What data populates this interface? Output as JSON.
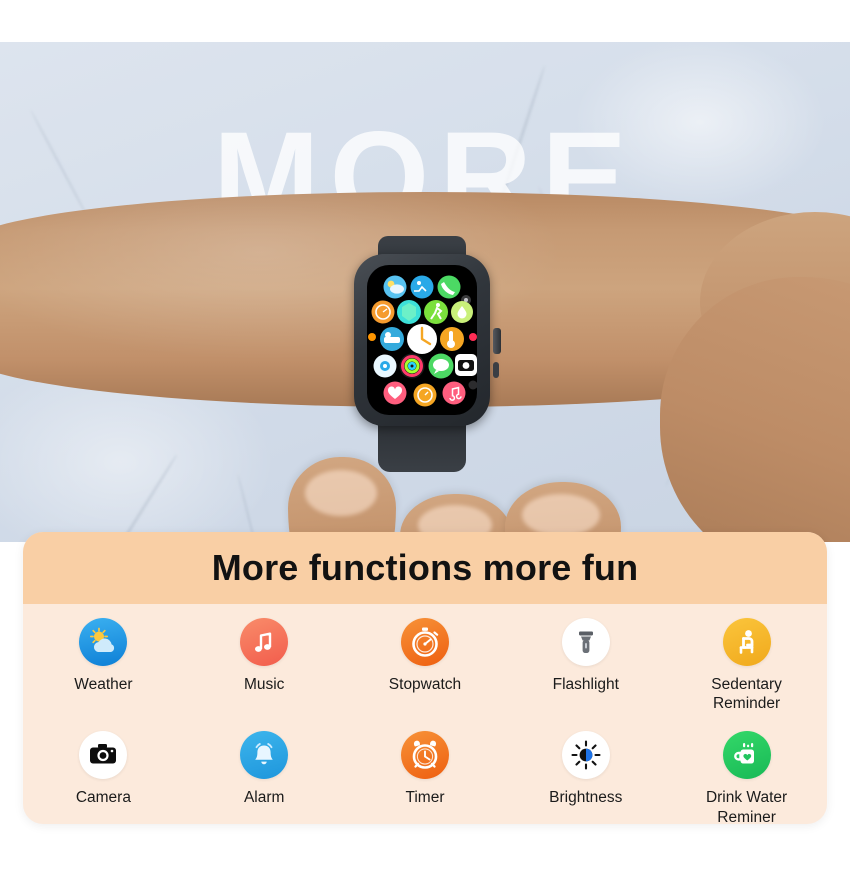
{
  "hero": {
    "background_word": "MORE",
    "device": "smartwatch-on-wrist",
    "watch_apps": [
      "weather",
      "cycling",
      "phone",
      "settings",
      "stopwatch",
      "hexagon",
      "running",
      "water-drop",
      "sleep",
      "clock-face",
      "thermometer",
      "compass",
      "activity-rings",
      "messages",
      "camera",
      "heart-rate",
      "alarm",
      "music"
    ]
  },
  "panel": {
    "title": "More functions more fun",
    "rows": [
      [
        {
          "label": "Weather",
          "icon": "weather-icon",
          "color": "#1E8FE0"
        },
        {
          "label": "Music",
          "icon": "music-icon",
          "color": "#F4775E"
        },
        {
          "label": "Stopwatch",
          "icon": "stopwatch-icon",
          "color": "#F57C20"
        },
        {
          "label": "Flashlight",
          "icon": "flashlight-icon",
          "color": "#FFFFFF"
        },
        {
          "label": "Sedentary Reminder",
          "label_line1": "Sedentary",
          "label_line2": "Reminder",
          "icon": "sedentary-icon",
          "color": "#F5B731"
        }
      ],
      [
        {
          "label": "Camera",
          "icon": "camera-icon",
          "color": "#FFFFFF"
        },
        {
          "label": "Alarm",
          "icon": "alarm-icon",
          "color": "#27A9E5"
        },
        {
          "label": "Timer",
          "icon": "timer-icon",
          "color": "#F57C20"
        },
        {
          "label": "Brightness",
          "icon": "brightness-icon",
          "color": "#FFFFFF"
        },
        {
          "label": "Drink Water Reminer",
          "label_line1": "Drink Water",
          "label_line2": "Reminer",
          "icon": "drink-water-icon",
          "color": "#22C55E"
        }
      ]
    ]
  },
  "colors": {
    "panel_header": "#F9CFA5",
    "panel_body": "#FCEADC",
    "title_text": "#121212",
    "label_text": "#1B1B1B"
  }
}
